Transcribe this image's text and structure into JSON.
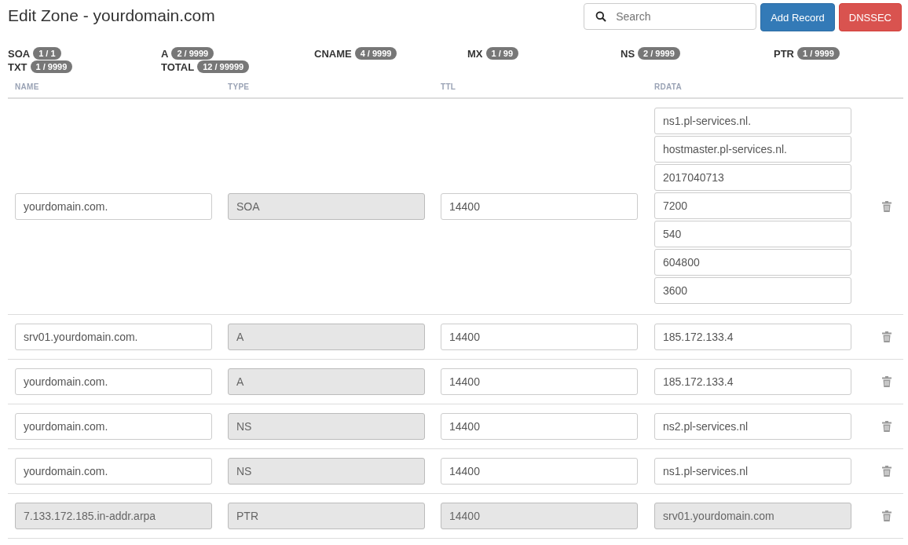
{
  "title": "Edit Zone - yourdomain.com",
  "search": {
    "placeholder": "Search"
  },
  "buttons": [
    {
      "label": "Add Record",
      "kind": "primary"
    },
    {
      "label": "DNSSEC",
      "kind": "danger"
    }
  ],
  "stats": [
    {
      "label": "SOA",
      "count": "1 / 1"
    },
    {
      "label": "A",
      "count": "2 / 9999"
    },
    {
      "label": "CNAME",
      "count": "4 / 9999"
    },
    {
      "label": "MX",
      "count": "1 / 99"
    },
    {
      "label": "NS",
      "count": "2 / 9999"
    },
    {
      "label": "PTR",
      "count": "1 / 9999"
    },
    {
      "label": "TXT",
      "count": "1 / 9999"
    },
    {
      "label": "TOTAL",
      "count": "12 / 99999"
    }
  ],
  "columns": [
    "NAME",
    "TYPE",
    "TTL",
    "RDATA"
  ],
  "rows": [
    {
      "name": {
        "value": "yourdomain.com.",
        "disabled": false
      },
      "type": {
        "value": "SOA",
        "disabled": true
      },
      "ttl": {
        "value": "14400",
        "disabled": false
      },
      "rdata": [
        {
          "value": "ns1.pl-services.nl.",
          "disabled": false
        },
        {
          "value": "hostmaster.pl-services.nl.",
          "disabled": false
        },
        {
          "value": "2017040713",
          "disabled": false
        },
        {
          "value": "7200",
          "disabled": false
        },
        {
          "value": "540",
          "disabled": false
        },
        {
          "value": "604800",
          "disabled": false
        },
        {
          "value": "3600",
          "disabled": false
        }
      ]
    },
    {
      "name": {
        "value": "srv01.yourdomain.com.",
        "disabled": false
      },
      "type": {
        "value": "A",
        "disabled": true
      },
      "ttl": {
        "value": "14400",
        "disabled": false
      },
      "rdata": [
        {
          "value": "185.172.133.4",
          "disabled": false
        }
      ]
    },
    {
      "name": {
        "value": "yourdomain.com.",
        "disabled": false
      },
      "type": {
        "value": "A",
        "disabled": true
      },
      "ttl": {
        "value": "14400",
        "disabled": false
      },
      "rdata": [
        {
          "value": "185.172.133.4",
          "disabled": false
        }
      ]
    },
    {
      "name": {
        "value": "yourdomain.com.",
        "disabled": false
      },
      "type": {
        "value": "NS",
        "disabled": true
      },
      "ttl": {
        "value": "14400",
        "disabled": false
      },
      "rdata": [
        {
          "value": "ns2.pl-services.nl",
          "disabled": false
        }
      ]
    },
    {
      "name": {
        "value": "yourdomain.com.",
        "disabled": false
      },
      "type": {
        "value": "NS",
        "disabled": true
      },
      "ttl": {
        "value": "14400",
        "disabled": false
      },
      "rdata": [
        {
          "value": "ns1.pl-services.nl",
          "disabled": false
        }
      ]
    },
    {
      "name": {
        "value": "7.133.172.185.in-addr.arpa",
        "disabled": true
      },
      "type": {
        "value": "PTR",
        "disabled": true
      },
      "ttl": {
        "value": "14400",
        "disabled": true
      },
      "rdata": [
        {
          "value": "srv01.yourdomain.com",
          "disabled": true
        }
      ]
    }
  ]
}
